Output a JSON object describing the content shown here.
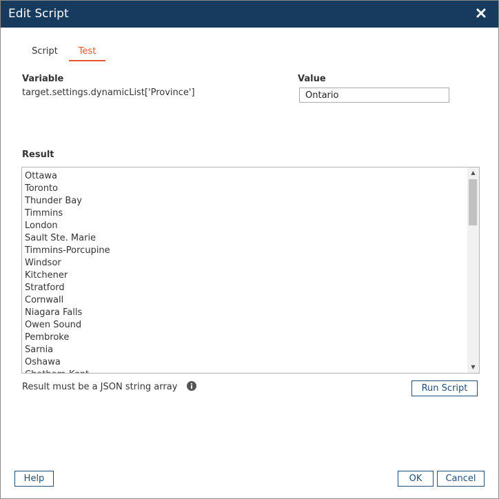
{
  "dialog": {
    "title": "Edit Script",
    "close_icon": "close-icon"
  },
  "tabs": [
    {
      "label": "Script",
      "active": false
    },
    {
      "label": "Test",
      "active": true
    }
  ],
  "variable": {
    "label": "Variable",
    "value": "target.settings.dynamicList['Province']"
  },
  "value_field": {
    "label": "Value",
    "value": "Ontario"
  },
  "result": {
    "label": "Result",
    "lines": [
      "Ottawa",
      "Toronto",
      "Thunder Bay",
      "Timmins",
      "London",
      "Sault Ste. Marie",
      "Timmins-Porcupine",
      "Windsor",
      "Kitchener",
      "Stratford",
      "Cornwall",
      "Niagara Falls",
      "Owen Sound",
      "Pembroke",
      "Sarnia",
      "Oshawa",
      "Chatham-Kent"
    ]
  },
  "hint": {
    "text": "Result must be a JSON string array",
    "icon": "info-icon"
  },
  "buttons": {
    "run_script": "Run Script",
    "help": "Help",
    "ok": "OK",
    "cancel": "Cancel"
  },
  "colors": {
    "titlebar": "#173b5e",
    "accent": "#e8562a",
    "button_border": "#1f4e7a"
  }
}
